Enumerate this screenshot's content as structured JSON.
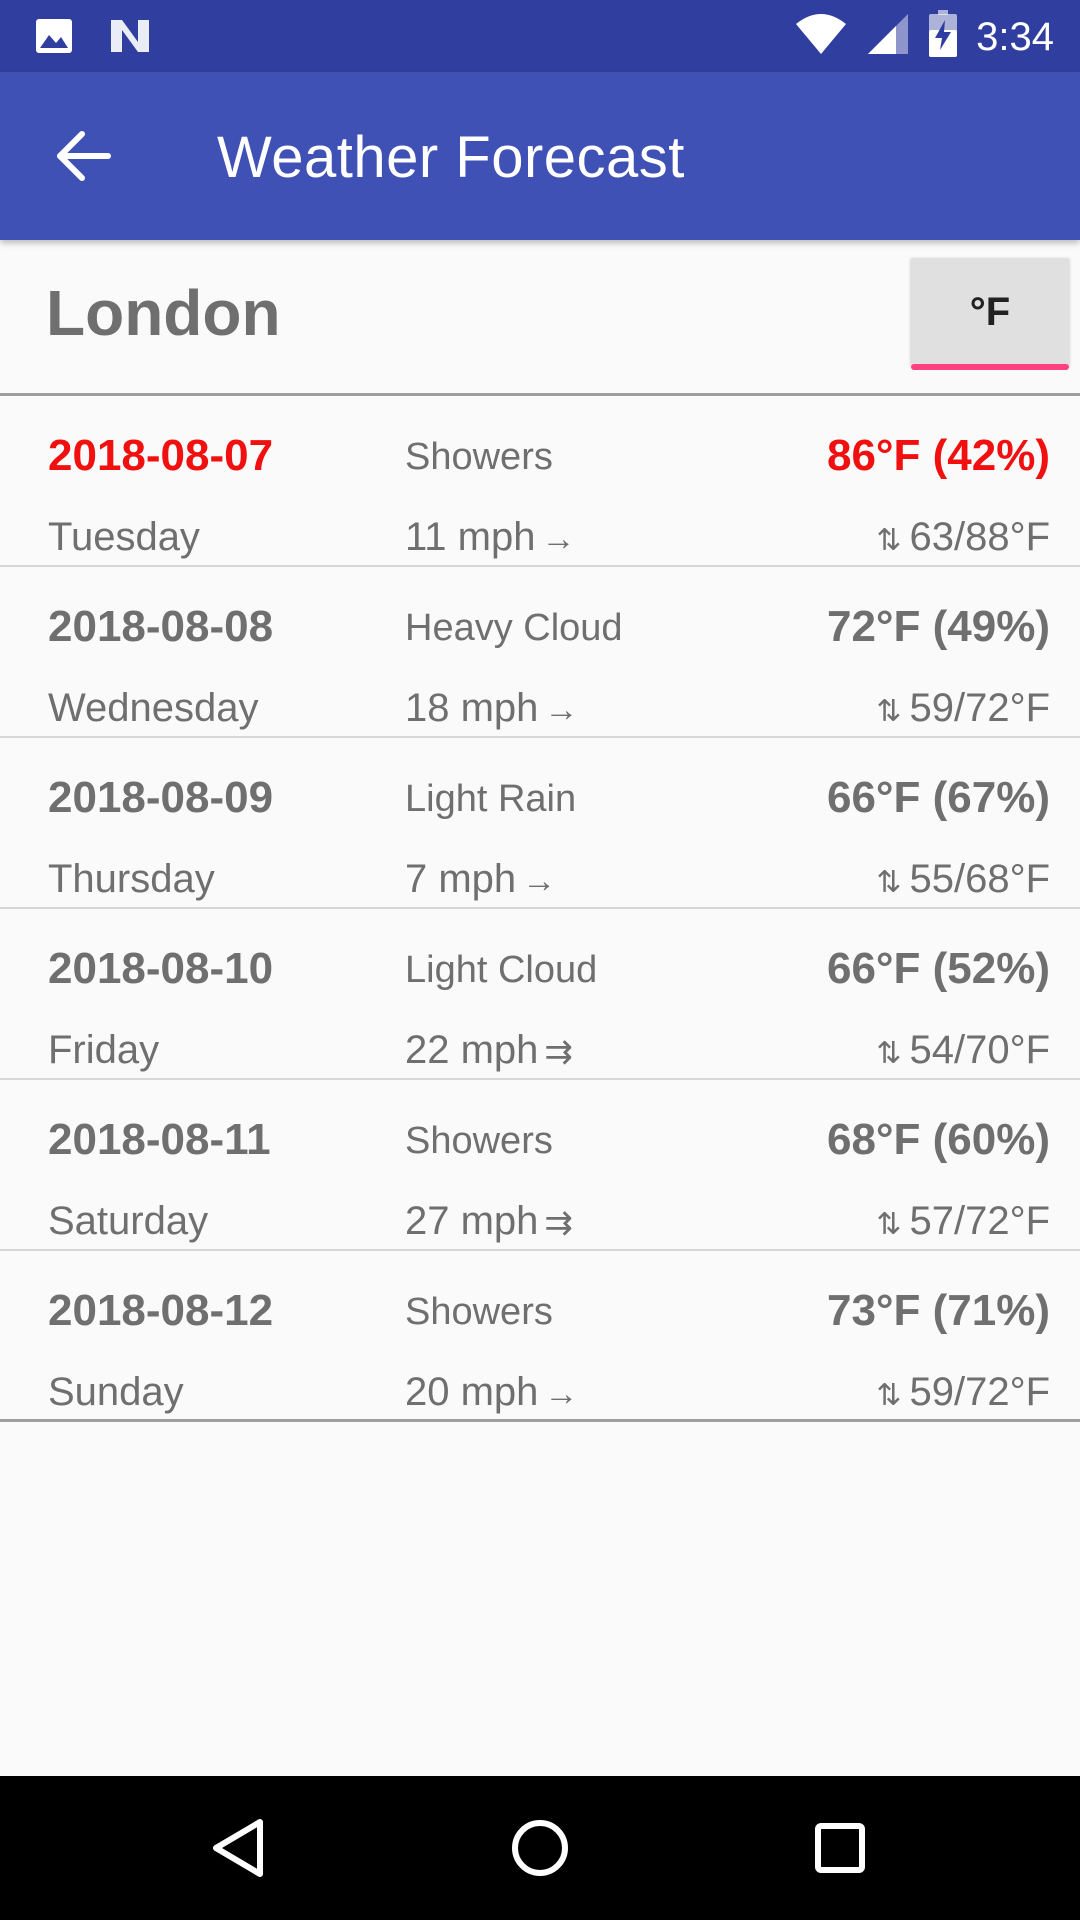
{
  "status_bar": {
    "time": "3:34",
    "icons": [
      "image-icon",
      "n-logo-icon",
      "wifi-icon",
      "signal-icon",
      "battery-charging-icon"
    ]
  },
  "app_bar": {
    "title": "Weather Forecast",
    "back_icon": "arrow-left-icon"
  },
  "city": {
    "name": "London",
    "unit_toggle_label": "°F"
  },
  "colors": {
    "status_bar": "#303f9f",
    "app_bar": "#3f51b5",
    "today_highlight": "#f01010",
    "accent": "#ff4081"
  },
  "forecast": [
    {
      "date": "2018-08-07",
      "day": "Tuesday",
      "condition": "Showers",
      "wind": "11 mph",
      "wind_arrow": "→",
      "temp": "86°F (42%)",
      "range": "63/88°F",
      "range_icon": "⇅"
    },
    {
      "date": "2018-08-08",
      "day": "Wednesday",
      "condition": "Heavy Cloud",
      "wind": "18 mph",
      "wind_arrow": "→",
      "temp": "72°F (49%)",
      "range": "59/72°F",
      "range_icon": "⇅"
    },
    {
      "date": "2018-08-09",
      "day": "Thursday",
      "condition": "Light Rain",
      "wind": "7 mph",
      "wind_arrow": "→",
      "temp": "66°F (67%)",
      "range": "55/68°F",
      "range_icon": "⇅"
    },
    {
      "date": "2018-08-10",
      "day": "Friday",
      "condition": "Light Cloud",
      "wind": "22 mph",
      "wind_arrow": "⇉",
      "temp": "66°F (52%)",
      "range": "54/70°F",
      "range_icon": "⇅"
    },
    {
      "date": "2018-08-11",
      "day": "Saturday",
      "condition": "Showers",
      "wind": "27 mph",
      "wind_arrow": "⇉",
      "temp": "68°F (60%)",
      "range": "57/72°F",
      "range_icon": "⇅"
    },
    {
      "date": "2018-08-12",
      "day": "Sunday",
      "condition": "Showers",
      "wind": "20 mph",
      "wind_arrow": "→",
      "temp": "73°F (71%)",
      "range": "59/72°F",
      "range_icon": "⇅"
    }
  ],
  "nav_bar": {
    "icons": [
      "nav-back-icon",
      "nav-home-icon",
      "nav-recents-icon"
    ]
  }
}
